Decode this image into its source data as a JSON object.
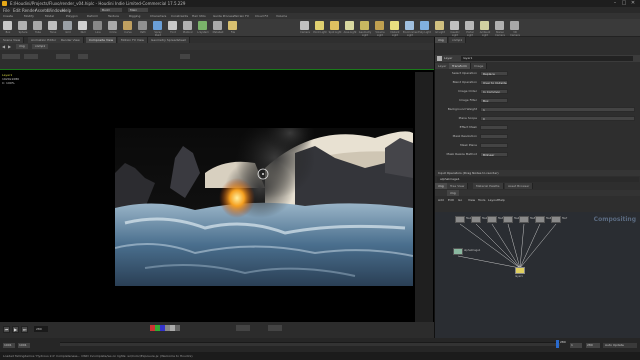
{
  "window": {
    "title": "E:/Houdini/Projects/Fluxo/render_v04.hiplc - Houdini Indie Limited-Commercial 17.5.229",
    "controls": [
      "–",
      "□",
      "✕"
    ]
  },
  "menubar": [
    "File",
    "Edit",
    "Render",
    "Assets",
    "Windows",
    "Help"
  ],
  "build_label": "Build",
  "desktop_label": "Main",
  "shelf_tabs": [
    "Create",
    "Modify",
    "Model",
    "Polygon",
    "Deform",
    "Texture",
    "Rigging",
    "Characters",
    "Constraints",
    "Hair Utils",
    "Guide Process",
    "Terrain FX",
    "Cloud FX",
    "Volume"
  ],
  "shelf_tools": [
    {
      "label": "Box",
      "color": "#c8c8c8"
    },
    {
      "label": "Sphere",
      "color": "#b0b0b0"
    },
    {
      "label": "Tube",
      "color": "#a8a8a8"
    },
    {
      "label": "Torus",
      "color": "#bfbfbf"
    },
    {
      "label": "Grid",
      "color": "#9aa0a6"
    },
    {
      "label": "Null",
      "color": "#d0d0d0"
    },
    {
      "label": "Line",
      "color": "#888"
    },
    {
      "label": "Circle",
      "color": "#aaa"
    },
    {
      "label": "Curve",
      "color": "#c0a060"
    },
    {
      "label": "Path",
      "color": "#909090"
    },
    {
      "label": "Spray Paint",
      "color": "#6a9fd8"
    },
    {
      "label": "Font",
      "color": "#c8c8c8"
    },
    {
      "label": "Platonic",
      "color": "#b0b0b0"
    },
    {
      "label": "L-System",
      "color": "#7ab36a"
    },
    {
      "label": "Metaball",
      "color": "#aaa"
    },
    {
      "label": "File",
      "color": "#d8c070"
    }
  ],
  "light_tools": [
    {
      "label": "Camera",
      "color": "#c0c0c0"
    },
    {
      "label": "Point Light",
      "color": "#e0d070"
    },
    {
      "label": "Spot Light",
      "color": "#e0c060"
    },
    {
      "label": "Area Light",
      "color": "#d8d8a0"
    },
    {
      "label": "Geometry Light",
      "color": "#c8b860"
    },
    {
      "label": "Volume Light",
      "color": "#c0a050"
    },
    {
      "label": "Distant Light",
      "color": "#e8e080"
    },
    {
      "label": "Environment Light",
      "color": "#a0c0e0"
    },
    {
      "label": "Sky Light",
      "color": "#80b0e0"
    },
    {
      "label": "GI Light",
      "color": "#d0c080"
    },
    {
      "label": "Caustic Light",
      "color": "#c0c0c0"
    },
    {
      "label": "Portal Light",
      "color": "#b8b8b8"
    },
    {
      "label": "Ambient Light",
      "color": "#d0d0a0"
    },
    {
      "label": "Stereo Camera",
      "color": "#b0b0b0"
    },
    {
      "label": "VR Camera",
      "color": "#a8a8a8"
    }
  ],
  "pane_tabs": [
    "Scene View",
    "Animation Editor",
    "Render View",
    "Composite View",
    "Motion FX View",
    "Geometry Spreadsheet"
  ],
  "path": {
    "context": "img",
    "node": "comp1"
  },
  "viewport_info": {
    "line1": "Layer1",
    "line2": "1920x1080",
    "line3": "C: 100%"
  },
  "playbar": {
    "frame": "280",
    "start": "1",
    "end": "280",
    "range_start": "1001",
    "range_end": "1001",
    "ticks": [
      "1",
      "50",
      "100",
      "150",
      "200",
      "250"
    ],
    "current_label": "280",
    "auto_update": "Auto Update"
  },
  "status_text": "Loaded Tellingdemos 'Hydrous 2.0' Completeness... OSID Incomplete/ws on lights: wr/Color/Exposure.js: (Welcome to Houdini)",
  "right_pane": {
    "top_tabs": [
      "img",
      "comp1"
    ],
    "node_type": "Layer",
    "node_name": "layer1",
    "param_tabs": [
      "Layer",
      "Transform",
      "Image"
    ],
    "params": [
      {
        "label": "Select Operation",
        "value": "Replace"
      },
      {
        "label": "Blend Operation",
        "value": "Over to Outside"
      },
      {
        "label": "Image Order",
        "value": "In Common"
      },
      {
        "label": "Image Filter",
        "value": "Box"
      },
      {
        "label": "Background Weight",
        "value": "1"
      },
      {
        "label": "Plane Scope",
        "value": "C"
      },
      {
        "label": "Effect Mask",
        "value": ""
      },
      {
        "label": "Mask Resolution",
        "value": ""
      },
      {
        "label": "Mask Plane",
        "value": ""
      },
      {
        "label": "Mask Resize Method",
        "value": "Bilinear"
      }
    ],
    "input_ops_label": "Input Operators (Drag Nodes to reorder)",
    "input_op": "alphaImage1",
    "net_tabs": [
      "img",
      "Tree View",
      "Material Palette",
      "Asset Browser"
    ],
    "net_path": "img",
    "net_menu": [
      "Add",
      "Edit",
      "Go",
      "View",
      "Tools",
      "Layout",
      "Help"
    ],
    "net_context_label": "Compositing",
    "nodes": [
      "file1",
      "file2",
      "file3",
      "file4",
      "file5",
      "file6",
      "file7"
    ],
    "merge_node": "layer1",
    "side_node": "alphaImage1"
  },
  "colors": {
    "accent": "#e6a817",
    "viewport_frame": "#1a7a1a",
    "node_selected": "#e0d060"
  }
}
